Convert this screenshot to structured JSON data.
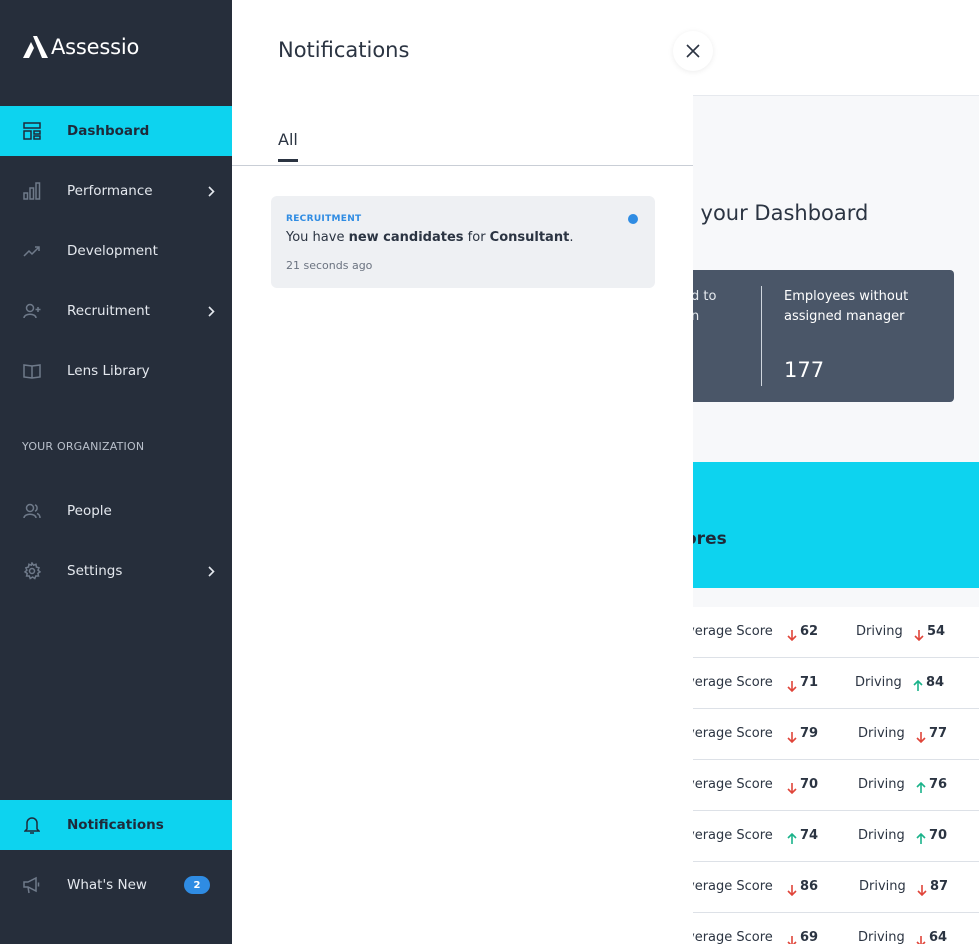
{
  "brand": {
    "name": "Assessio"
  },
  "sidebar": {
    "items": [
      {
        "id": "dashboard",
        "label": "Dashboard",
        "icon": "dashboard-icon",
        "active": true,
        "chevron": false
      },
      {
        "id": "performance",
        "label": "Performance",
        "icon": "bar-chart-icon",
        "active": false,
        "chevron": true
      },
      {
        "id": "development",
        "label": "Development",
        "icon": "trend-up-icon",
        "active": false,
        "chevron": false
      },
      {
        "id": "recruitment",
        "label": "Recruitment",
        "icon": "user-plus-icon",
        "active": false,
        "chevron": true
      },
      {
        "id": "lens-library",
        "label": "Lens Library",
        "icon": "book-icon",
        "active": false,
        "chevron": false
      }
    ],
    "section_title": "YOUR ORGANIZATION",
    "org_items": [
      {
        "id": "people",
        "label": "People",
        "icon": "people-icon",
        "chevron": false
      },
      {
        "id": "settings",
        "label": "Settings",
        "icon": "gear-icon",
        "chevron": true
      }
    ],
    "bottom_items": [
      {
        "id": "notifications",
        "label": "Notifications",
        "icon": "bell-icon",
        "active": true
      },
      {
        "id": "whats-new",
        "label": "What's New",
        "icon": "megaphone-icon",
        "badge": "2"
      }
    ]
  },
  "notifications_panel": {
    "title": "Notifications",
    "tabs": [
      {
        "label": "All",
        "active": true
      }
    ],
    "items": [
      {
        "category": "RECRUITMENT",
        "message_prefix": "You have ",
        "message_bold1": "new candidates",
        "message_middle": " for ",
        "message_bold2": "Consultant",
        "message_suffix": ".",
        "time": "21 seconds ago",
        "unread": true
      }
    ]
  },
  "dashboard": {
    "welcome_partial": "o your Dashboard",
    "stats": {
      "cut_label_line1": "ed to",
      "cut_label_line2": "on",
      "label": "Employees without assigned manager",
      "value": "177"
    },
    "scores_title_partial": "ores",
    "avg_label_partial": "verage Score",
    "driving_label": "Driving",
    "rows": [
      {
        "avg": "62",
        "avg_dir": "down",
        "drv": "54",
        "drv_dir": "down"
      },
      {
        "avg": "71",
        "avg_dir": "down",
        "drv": "84",
        "drv_dir": "up"
      },
      {
        "avg": "79",
        "avg_dir": "down",
        "drv": "77",
        "drv_dir": "down"
      },
      {
        "avg": "70",
        "avg_dir": "down",
        "drv": "76",
        "drv_dir": "up"
      },
      {
        "avg": "74",
        "avg_dir": "up",
        "drv": "70",
        "drv_dir": "up"
      },
      {
        "avg": "86",
        "avg_dir": "down",
        "drv": "87",
        "drv_dir": "down"
      },
      {
        "avg": "69",
        "avg_dir": "down",
        "drv": "64",
        "drv_dir": "down"
      }
    ]
  },
  "colors": {
    "sidebar_bg": "#262e3b",
    "accent": "#0dd3ef",
    "link_blue": "#2f8ce3",
    "down_red": "#e0453a",
    "up_green": "#1bb38a"
  }
}
